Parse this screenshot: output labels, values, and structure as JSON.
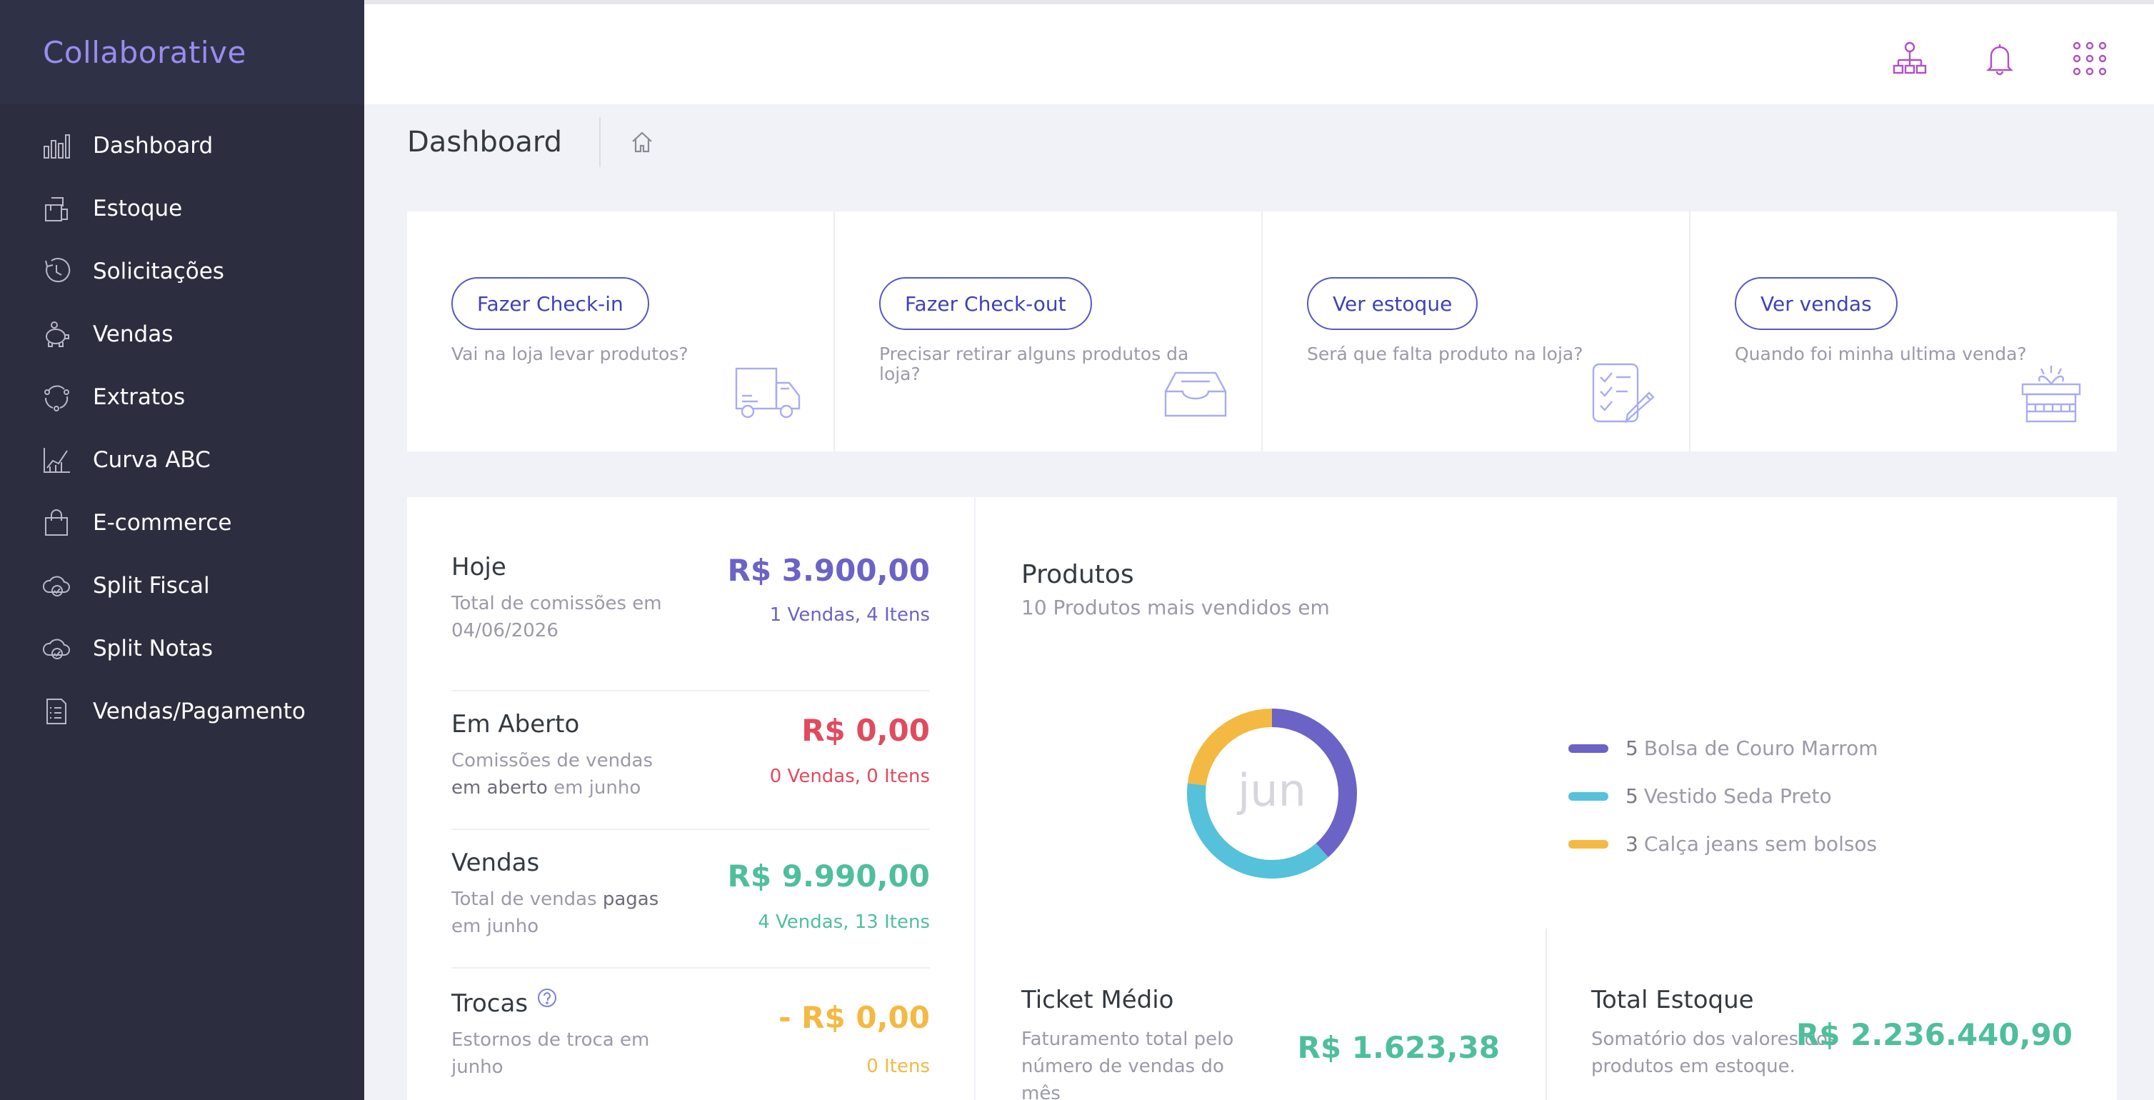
{
  "app": {
    "brand": "Collaborative"
  },
  "sidebar": {
    "items": [
      {
        "label": "Dashboard",
        "icon": "bar-chart-icon"
      },
      {
        "label": "Estoque",
        "icon": "boxes-icon"
      },
      {
        "label": "Solicitações",
        "icon": "clock-refresh-icon"
      },
      {
        "label": "Vendas",
        "icon": "piggy-bank-icon"
      },
      {
        "label": "Extratos",
        "icon": "cycle-icon"
      },
      {
        "label": "Curva ABC",
        "icon": "line-chart-icon"
      },
      {
        "label": "E-commerce",
        "icon": "shopping-bag-icon"
      },
      {
        "label": "Split Fiscal",
        "icon": "cloud-check-icon"
      },
      {
        "label": "Split Notas",
        "icon": "cloud-check-icon"
      },
      {
        "label": "Vendas/Pagamento",
        "icon": "document-list-icon"
      }
    ]
  },
  "topbar": {
    "icons": [
      "org-chart-icon",
      "bell-icon",
      "apps-grid-icon"
    ]
  },
  "page": {
    "title": "Dashboard"
  },
  "actions": [
    {
      "label": "Fazer Check-in",
      "desc": "Vai na loja levar produtos?",
      "icon": "truck-icon"
    },
    {
      "label": "Fazer Check-out",
      "desc": "Precisar retirar alguns produtos da loja?",
      "icon": "inbox-tray-icon"
    },
    {
      "label": "Ver estoque",
      "desc": "Será que falta produto na loja?",
      "icon": "checklist-icon"
    },
    {
      "label": "Ver vendas",
      "desc": "Quando foi minha ultima venda?",
      "icon": "gift-icon"
    }
  ],
  "stats": {
    "hoje": {
      "title": "Hoje",
      "desc": "Total de comissões em 04/06/2026",
      "value": "R$ 3.900,00",
      "sub": "1 Vendas, 4 Itens"
    },
    "aberto": {
      "title": "Em Aberto",
      "desc_1": "Comissões de vendas ",
      "desc_b1": "em aberto",
      "desc_2": " em junho",
      "value": "R$ 0,00",
      "sub": "0 Vendas, 0 Itens"
    },
    "vendas": {
      "title": "Vendas",
      "desc_1": "Total de vendas ",
      "desc_b1": "pagas",
      "desc_2": " em junho",
      "value": "R$ 9.990,00",
      "sub": "4 Vendas, 13 Itens"
    },
    "trocas": {
      "title": "Trocas",
      "desc": "Estornos de troca em junho",
      "value": "- R$ 0,00",
      "sub": "0 Itens"
    }
  },
  "colors": {
    "purple": "#6b63c6",
    "red": "#e04b5d",
    "green": "#4fbf9a",
    "orange": "#f4b942",
    "cyan": "#55c1da"
  },
  "products": {
    "title": "Produtos",
    "subtitle": "10 Produtos mais vendidos em",
    "center_label": "jun",
    "legend": [
      {
        "count": "5",
        "name": "Bolsa de Couro Marrom",
        "color": "#6b63c6"
      },
      {
        "count": "5",
        "name": "Vestido Seda Preto",
        "color": "#55c1da"
      },
      {
        "count": "3",
        "name": "Calça jeans sem bolsos",
        "color": "#f4b942"
      }
    ]
  },
  "chart_data": {
    "type": "pie",
    "categories": [
      "Bolsa de Couro Marrom",
      "Vestido Seda Preto",
      "Calça jeans sem bolsos"
    ],
    "values": [
      5,
      5,
      3
    ],
    "title": "Produtos"
  },
  "kpis": {
    "ticket": {
      "title": "Ticket Médio",
      "desc": "Faturamento total pelo número de vendas do mês",
      "value": "R$ 1.623,38"
    },
    "estoque": {
      "title": "Total Estoque",
      "desc": "Somatório dos valores dos produtos em estoque.",
      "value": "R$ 2.236.440,90"
    }
  }
}
